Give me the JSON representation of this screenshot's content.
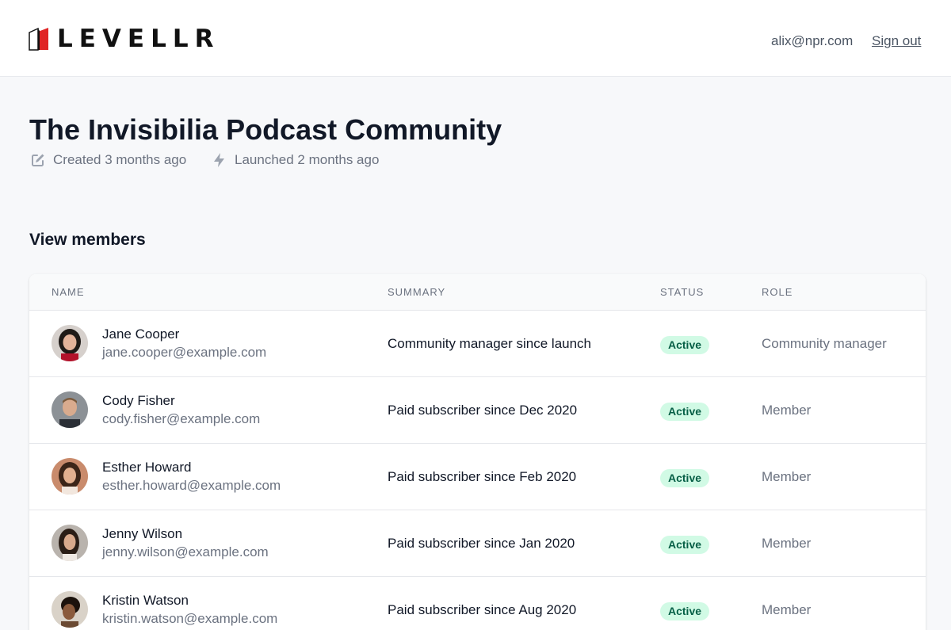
{
  "brand": {
    "name": "LEVELLR",
    "accent": "#e02424"
  },
  "header": {
    "user_email": "alix@npr.com",
    "sign_out": "Sign out"
  },
  "community": {
    "title": "The Invisibilia Podcast Community",
    "created": "Created 3 months ago",
    "launched": "Launched 2 months ago",
    "created_icon": "pencil-square-icon",
    "launched_icon": "lightning-bolt-icon"
  },
  "members_section": {
    "title": "View members"
  },
  "table": {
    "columns": [
      "Name",
      "Summary",
      "Status",
      "Role"
    ],
    "rows": [
      {
        "name": "Jane Cooper",
        "email": "jane.cooper@example.com",
        "summary": "Community manager since launch",
        "status": "Active",
        "role": "Community manager"
      },
      {
        "name": "Cody Fisher",
        "email": "cody.fisher@example.com",
        "summary": "Paid subscriber since Dec 2020",
        "status": "Active",
        "role": "Member"
      },
      {
        "name": "Esther Howard",
        "email": "esther.howard@example.com",
        "summary": "Paid subscriber since Feb 2020",
        "status": "Active",
        "role": "Member"
      },
      {
        "name": "Jenny Wilson",
        "email": "jenny.wilson@example.com",
        "summary": "Paid subscriber since Jan 2020",
        "status": "Active",
        "role": "Member"
      },
      {
        "name": "Kristin Watson",
        "email": "kristin.watson@example.com",
        "summary": "Paid subscriber since Aug 2020",
        "status": "Active",
        "role": "Member"
      }
    ]
  },
  "colors": {
    "status_active_bg": "#d1fae5",
    "status_active_text": "#065f46"
  }
}
